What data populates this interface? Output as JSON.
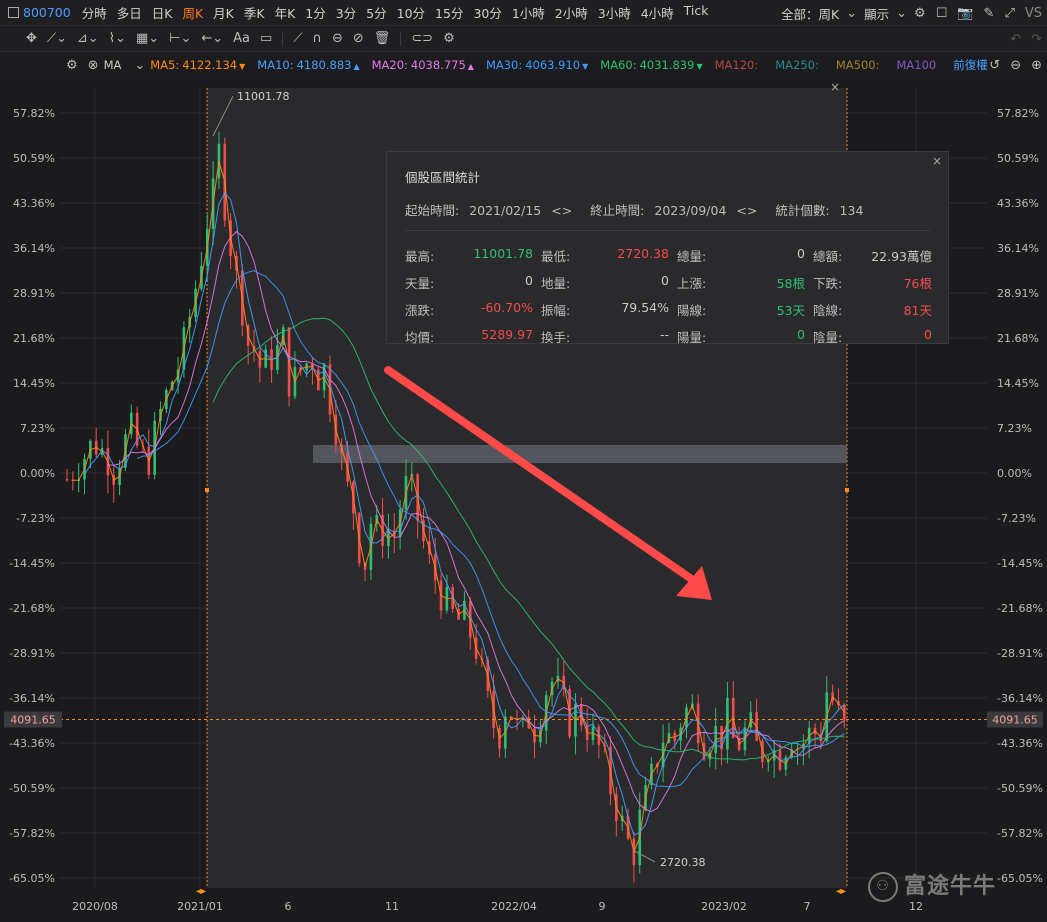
{
  "symbol": "800700",
  "timeframes": [
    "分時",
    "多日",
    "日K",
    "周K",
    "月K",
    "季K",
    "年K",
    "1分",
    "3分",
    "5分",
    "10分",
    "15分",
    "30分",
    "1小時",
    "2小時",
    "3小時",
    "4小時",
    "Tick"
  ],
  "active_timeframe": "周K",
  "top_right": {
    "range_label": "全部：周K",
    "display_label": "顯示"
  },
  "ma_bar": {
    "label": "MA",
    "items": [
      {
        "name": "MA5:",
        "value": "4122.134",
        "color": "#ff8c1a",
        "arrow": "▼"
      },
      {
        "name": "MA10:",
        "value": "4180.883",
        "color": "#4aa0ff",
        "arrow": "▲"
      },
      {
        "name": "MA20:",
        "value": "4038.775",
        "color": "#e27be8",
        "arrow": "▲"
      },
      {
        "name": "MA30:",
        "value": "4063.910",
        "color": "#3d9cff",
        "arrow": "▼"
      },
      {
        "name": "MA60:",
        "value": "4031.839",
        "color": "#2fbf71",
        "arrow": "▼"
      },
      {
        "name": "MA120:",
        "value": "",
        "color": "#b24a4a",
        "arrow": ""
      },
      {
        "name": "MA250:",
        "value": "",
        "color": "#2b8a8a",
        "arrow": ""
      },
      {
        "name": "MA500:",
        "value": "",
        "color": "#a08032",
        "arrow": ""
      },
      {
        "name": "MA100",
        "value": "",
        "color": "#7b5bbf",
        "arrow": ""
      }
    ],
    "adjust_label": "前復權"
  },
  "stats_panel": {
    "title": "個股區間統計",
    "start_label": "起始時間:",
    "start_value": "2021/02/15",
    "end_label": "終止時間:",
    "end_value": "2023/09/04",
    "count_label": "統計個數:",
    "count_value": "134",
    "rows": [
      [
        {
          "l": "最高:",
          "v": "11001.78",
          "c": "g"
        },
        {
          "l": "最低:",
          "v": "2720.38",
          "c": "r"
        },
        {
          "l": "總量:",
          "v": "0",
          "c": "n"
        },
        {
          "l": "總額:",
          "v": "22.93萬億",
          "c": "n"
        }
      ],
      [
        {
          "l": "天量:",
          "v": "0",
          "c": "n"
        },
        {
          "l": "地量:",
          "v": "0",
          "c": "n"
        },
        {
          "l": "上漲:",
          "v": "58根",
          "c": "g"
        },
        {
          "l": "下跌:",
          "v": "76根",
          "c": "r"
        }
      ],
      [
        {
          "l": "漲跌:",
          "v": "-60.70%",
          "c": "r"
        },
        {
          "l": "振幅:",
          "v": "79.54%",
          "c": "n"
        },
        {
          "l": "陽線:",
          "v": "53天",
          "c": "g"
        },
        {
          "l": "陰線:",
          "v": "81天",
          "c": "r"
        }
      ],
      [
        {
          "l": "均價:",
          "v": "5289.97",
          "c": "r"
        },
        {
          "l": "換手:",
          "v": "--",
          "c": "n"
        },
        {
          "l": "陽量:",
          "v": "0",
          "c": "g"
        },
        {
          "l": "陰量:",
          "v": "0",
          "c": "r"
        }
      ]
    ]
  },
  "axis": {
    "y_ticks": [
      "57.82%",
      "50.59%",
      "43.36%",
      "36.14%",
      "28.91%",
      "21.68%",
      "14.45%",
      "7.23%",
      "0.00%",
      "-7.23%",
      "-14.45%",
      "-21.68%",
      "-28.91%",
      "-36.14%",
      "-43.36%",
      "-50.59%",
      "-57.82%",
      "-65.05%"
    ],
    "x_ticks": [
      "2020/08",
      "2021/01",
      "6",
      "11",
      "2022/04",
      "9",
      "2023/02",
      "7",
      "12"
    ],
    "current_price": "4091.65"
  },
  "annotations": {
    "high_label": "11001.78",
    "low_label": "2720.38"
  },
  "watermark": "富途牛牛",
  "chart_data": {
    "type": "candlestick",
    "value_unit": "percent change",
    "y_range": [
      -65.05,
      57.82
    ],
    "x_dates": [
      "2020/08",
      "2021/01",
      "6",
      "11",
      "2022/04",
      "9",
      "2023/02",
      "7",
      "12"
    ],
    "ma_series": [
      {
        "name": "MA5",
        "color": "#ff8c1a"
      },
      {
        "name": "MA10",
        "color": "#4aa0ff"
      },
      {
        "name": "MA20",
        "color": "#e27be8"
      },
      {
        "name": "MA30",
        "color": "#3d9cff"
      },
      {
        "name": "MA60",
        "color": "#2fbf71"
      }
    ],
    "close_path": [
      [
        0,
        -1
      ],
      [
        8,
        2
      ],
      [
        15,
        5
      ],
      [
        22,
        3
      ],
      [
        27,
        0
      ],
      [
        31,
        4
      ],
      [
        36,
        7
      ],
      [
        41,
        3
      ],
      [
        46,
        2
      ],
      [
        52,
        9
      ],
      [
        58,
        14
      ],
      [
        64,
        18
      ],
      [
        70,
        26
      ],
      [
        76,
        35
      ],
      [
        80,
        42
      ],
      [
        84,
        46
      ],
      [
        86,
        52
      ],
      [
        88,
        46
      ],
      [
        91,
        39
      ],
      [
        95,
        32
      ],
      [
        98,
        28
      ],
      [
        101,
        24
      ],
      [
        103,
        19
      ],
      [
        106,
        20
      ],
      [
        110,
        16
      ],
      [
        113,
        18
      ],
      [
        117,
        19
      ],
      [
        120,
        20
      ],
      [
        123,
        22
      ],
      [
        126,
        13
      ],
      [
        130,
        16
      ],
      [
        134,
        17
      ],
      [
        138,
        19
      ],
      [
        141,
        15
      ],
      [
        145,
        17
      ],
      [
        149,
        11
      ],
      [
        153,
        6
      ],
      [
        157,
        -2
      ],
      [
        161,
        -4
      ],
      [
        164,
        -11
      ],
      [
        168,
        -15
      ],
      [
        172,
        -7
      ],
      [
        176,
        -10
      ],
      [
        180,
        -9
      ],
      [
        185,
        -10
      ],
      [
        189,
        -4
      ],
      [
        193,
        -1
      ],
      [
        197,
        -6
      ],
      [
        201,
        -11
      ],
      [
        205,
        -15
      ],
      [
        208,
        -17
      ],
      [
        212,
        -20
      ],
      [
        216,
        -22
      ],
      [
        220,
        -24
      ],
      [
        224,
        -23
      ],
      [
        228,
        -26
      ],
      [
        232,
        -29
      ],
      [
        236,
        -35
      ],
      [
        240,
        -40
      ],
      [
        244,
        -42
      ],
      [
        248,
        -37
      ],
      [
        252,
        -39
      ],
      [
        256,
        -43
      ],
      [
        260,
        -39
      ],
      [
        264,
        -41
      ],
      [
        268,
        -38
      ],
      [
        272,
        -33
      ],
      [
        276,
        -34
      ],
      [
        280,
        -37
      ],
      [
        284,
        -40
      ],
      [
        288,
        -38
      ],
      [
        292,
        -40
      ],
      [
        296,
        -42
      ],
      [
        300,
        -44
      ],
      [
        304,
        -47
      ],
      [
        308,
        -52
      ],
      [
        312,
        -55
      ],
      [
        316,
        -59
      ],
      [
        320,
        -61
      ],
      [
        323,
        -56
      ],
      [
        327,
        -52
      ],
      [
        331,
        -48
      ],
      [
        334,
        -45
      ],
      [
        338,
        -41
      ],
      [
        342,
        -44
      ],
      [
        346,
        -40
      ],
      [
        350,
        -38
      ],
      [
        354,
        -38
      ],
      [
        357,
        -41
      ],
      [
        361,
        -44
      ],
      [
        365,
        -41
      ],
      [
        369,
        -43
      ],
      [
        373,
        -39
      ],
      [
        377,
        -44
      ],
      [
        381,
        -43
      ],
      [
        385,
        -40
      ],
      [
        389,
        -44
      ],
      [
        393,
        -45
      ],
      [
        397,
        -43
      ],
      [
        401,
        -46
      ],
      [
        405,
        -44
      ],
      [
        409,
        -42
      ],
      [
        413,
        -44
      ],
      [
        417,
        -43
      ],
      [
        421,
        -41
      ],
      [
        425,
        -43
      ],
      [
        429,
        -35
      ],
      [
        433,
        -37
      ],
      [
        437,
        -40
      ],
      [
        441,
        -42
      ]
    ]
  }
}
